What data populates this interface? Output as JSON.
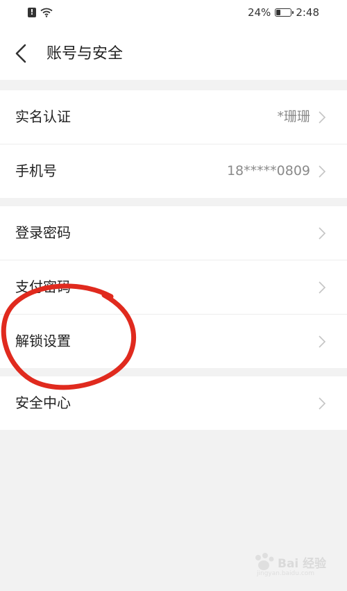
{
  "status_bar": {
    "battery_percent": "24%",
    "battery_level": 0.24,
    "time": "2:48"
  },
  "header": {
    "title": "账号与安全"
  },
  "groups": [
    {
      "items": [
        {
          "label": "实名认证",
          "value": "*珊珊"
        },
        {
          "label": "手机号",
          "value": "18*****0809"
        }
      ]
    },
    {
      "items": [
        {
          "label": "登录密码"
        },
        {
          "label": "支付密码"
        },
        {
          "label": "解锁设置"
        }
      ]
    },
    {
      "items": [
        {
          "label": "安全中心"
        }
      ]
    }
  ],
  "annotation": {
    "shape": "ellipse",
    "color": "#e02a1e"
  },
  "watermark": {
    "text": "Bai 经验",
    "url_text": "jingyan.baidu.com"
  }
}
